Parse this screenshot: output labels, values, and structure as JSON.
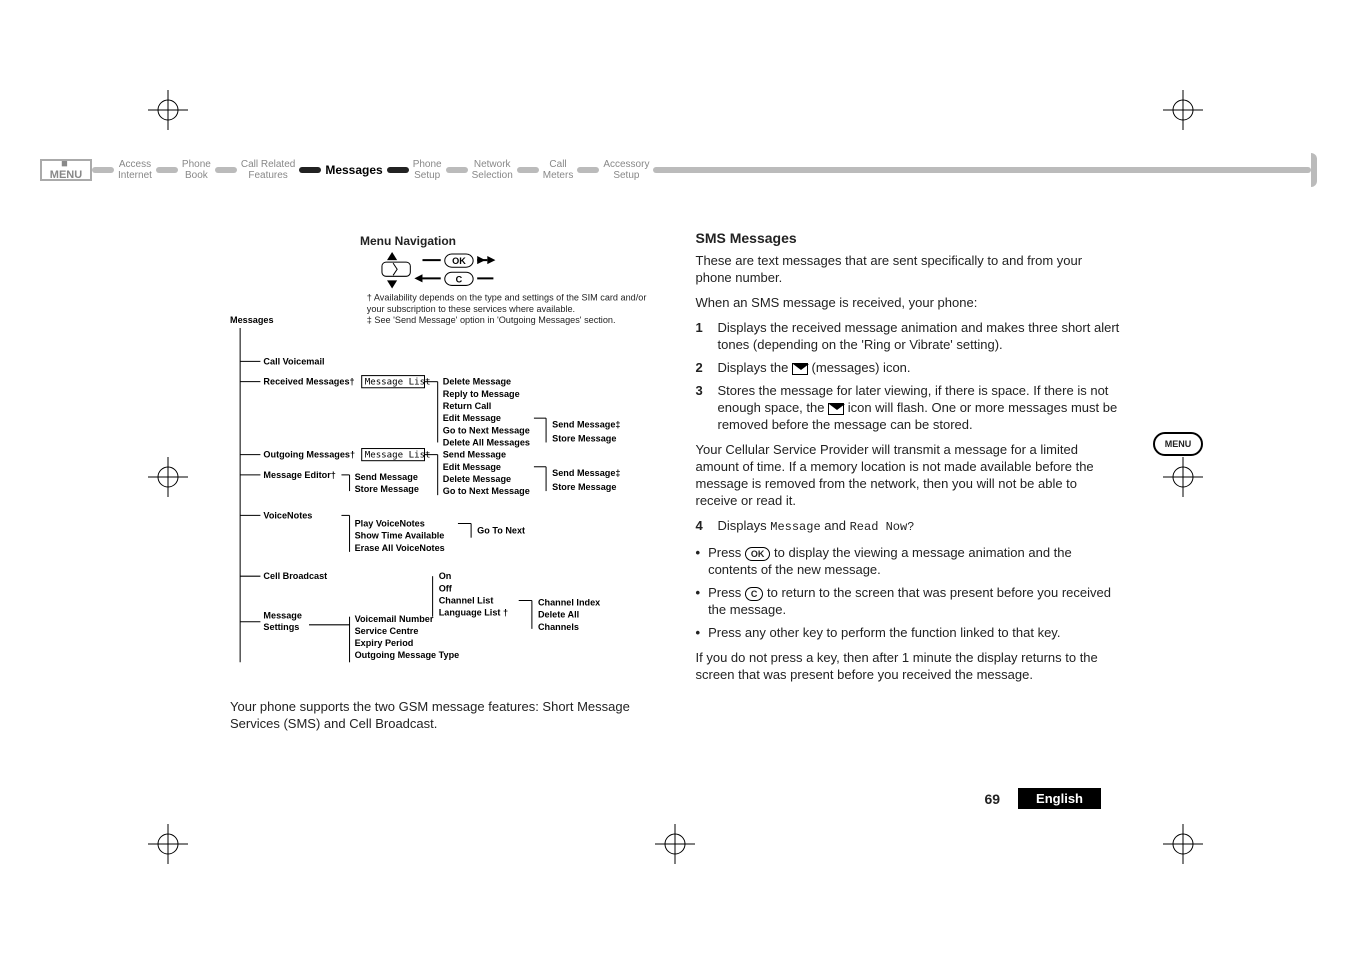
{
  "nav": {
    "menu": "MENU",
    "items": [
      {
        "l1": "Access",
        "l2": "Internet"
      },
      {
        "l1": "Phone",
        "l2": "Book"
      },
      {
        "l1": "Call Related",
        "l2": "Features"
      },
      {
        "l1": "Messages",
        "l2": ""
      },
      {
        "l1": "Phone",
        "l2": "Setup"
      },
      {
        "l1": "Network",
        "l2": "Selection"
      },
      {
        "l1": "Call",
        "l2": "Meters"
      },
      {
        "l1": "Accessory",
        "l2": "Setup"
      }
    ]
  },
  "diagram": {
    "title": "Menu Navigation",
    "note_dagger": "† Availability depends on the type and settings of the SIM card and/or your subscription to these services where available.",
    "note_ddagger": "‡ See 'Send Message' option in 'Outgoing Messages' section.",
    "root": "Messages",
    "branches": {
      "call_voicemail": "Call Voicemail",
      "received_msgs": "Received Messages†",
      "received_msgs_box": "Message List",
      "received_children": [
        "Delete Message",
        "Reply to Message",
        "Return Call",
        "Edit Message",
        "Go to Next Message",
        "Delete All Messages"
      ],
      "received_sub": [
        "Send Message‡",
        "Store Message"
      ],
      "outgoing_msgs": "Outgoing Messages†",
      "outgoing_msgs_box": "Message List",
      "outgoing_children": [
        "Send Message",
        "Edit Message",
        "Delete Message",
        "Go to Next Message"
      ],
      "outgoing_sub": [
        "Send Message‡",
        "Store Message"
      ],
      "msg_editor": "Message Editor†",
      "msg_editor_children": [
        "Send Message",
        "Store Message"
      ],
      "voicenotes": "VoiceNotes",
      "voicenotes_children": [
        "Play VoiceNotes",
        "Show Time Available",
        "Erase All VoiceNotes"
      ],
      "voicenotes_sub": [
        "Go To Next"
      ],
      "cell_broadcast": "Cell Broadcast",
      "cell_children": [
        "On",
        "Off",
        "Channel List",
        "Language List †"
      ],
      "cell_sub": [
        "Channel Index",
        "Delete All Channels"
      ],
      "msg_settings": "Message Settings",
      "msg_settings_children": [
        "Voicemail Number",
        "Service Centre",
        "Expiry Period",
        "Outgoing Message Type"
      ]
    }
  },
  "left_caption": "Your phone supports the two GSM message features: Short Message Services (SMS) and Cell Broadcast.",
  "right": {
    "h": "SMS Messages",
    "p1": "These are text messages that are sent specifically to and from your phone number.",
    "p2": "When an SMS message is received, your phone:",
    "step1": "Displays the received message animation and makes three short alert tones (depending on the 'Ring or Vibrate' setting).",
    "step2a": "Displays the ",
    "step2b": " (messages) icon.",
    "step3a": "Stores the message for later viewing, if there is space. If there is not enough space, the ",
    "step3b": " icon will flash. One or more messages must be removed before the message can be stored.",
    "p3": "Your Cellular Service Provider will transmit a message for a limited amount of time. If a memory location is not made available before the message is removed from the network, then you will not be able to receive or read it.",
    "step4a": "Displays ",
    "step4m1": "Message",
    "step4b": " and ",
    "step4m2": "Read Now?",
    "bul1a": "Press ",
    "bul1b": " to display the viewing a message animation and the contents of the new message.",
    "bul2a": "Press ",
    "bul2b": " to return to the screen that was present before you received the message.",
    "bul3": "Press any other key to perform the function linked to that key.",
    "p4": "If you do not press a key, then after 1 minute the display returns to the screen that was present before you received the message.",
    "ok_label": "OK",
    "c_label": "C"
  },
  "side_badge": "MENU",
  "footer": {
    "page": "69",
    "lang": "English"
  }
}
